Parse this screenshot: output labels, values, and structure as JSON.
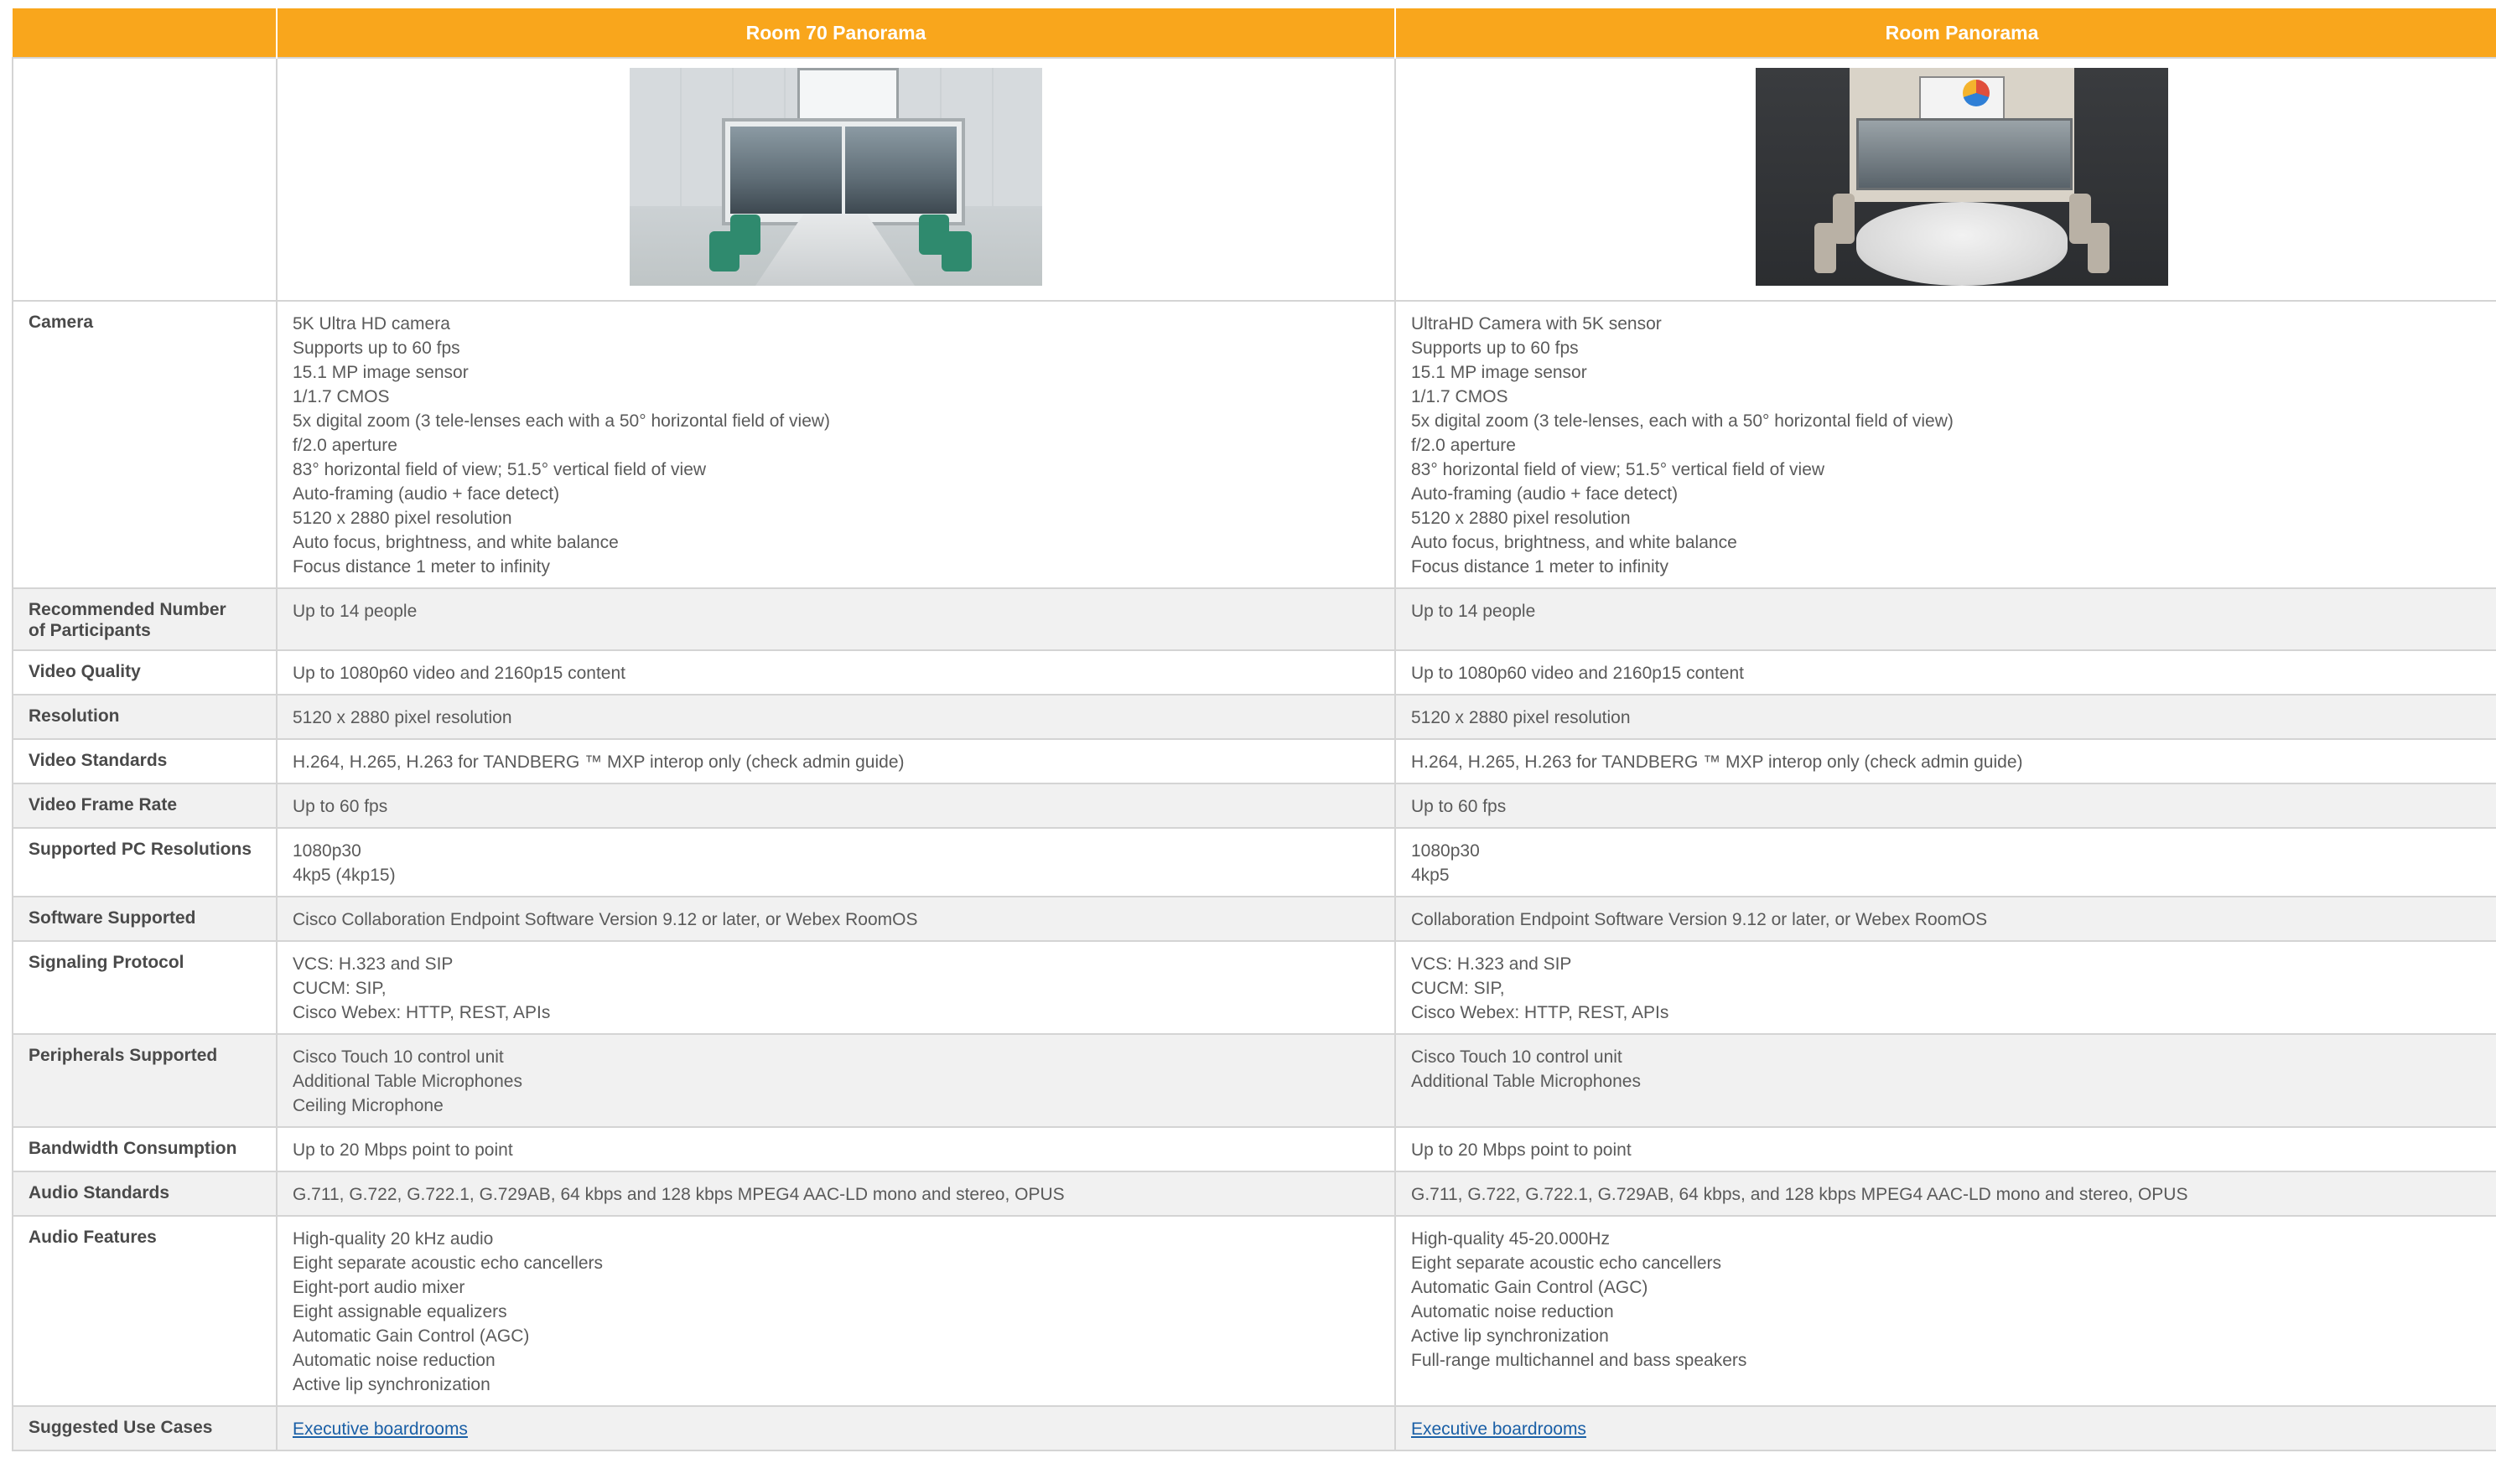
{
  "header": {
    "col1": "Room 70 Panorama",
    "col2": "Room Panorama"
  },
  "images": {
    "col1": "Room 70 Panorama meeting room photo",
    "col2": "Room Panorama meeting room photo"
  },
  "rows": [
    {
      "label": "Camera",
      "col1": [
        "5K Ultra HD camera",
        "Supports up to 60 fps",
        "15.1 MP image sensor",
        "1/1.7 CMOS",
        "5x digital zoom (3 tele-lenses each with a 50° horizontal field of view)",
        "f/2.0 aperture",
        "83° horizontal field of view; 51.5° vertical field of view",
        "Auto-framing (audio + face detect)",
        "5120 x 2880 pixel resolution",
        "Auto focus, brightness, and white balance",
        "Focus distance 1 meter to infinity"
      ],
      "col2": [
        "UltraHD Camera with 5K sensor",
        "Supports up to 60 fps",
        "15.1 MP image sensor",
        "1/1.7 CMOS",
        "5x digital zoom (3 tele-lenses, each with a 50° horizontal field of view)",
        "f/2.0 aperture",
        "83° horizontal field of view; 51.5° vertical field of view",
        "Auto-framing (audio + face detect)",
        "5120 x 2880 pixel resolution",
        "Auto focus, brightness, and white balance",
        "Focus distance 1 meter to infinity"
      ]
    },
    {
      "label_lines": [
        "Recommended Number",
        "of Participants"
      ],
      "col1": [
        "Up to 14 people"
      ],
      "col2": [
        "Up to 14 people"
      ]
    },
    {
      "label": "Video Quality",
      "col1": [
        "Up to 1080p60 video and 2160p15 content"
      ],
      "col2": [
        "Up to 1080p60 video and 2160p15 content"
      ]
    },
    {
      "label": "Resolution",
      "col1": [
        "5120 x 2880 pixel resolution"
      ],
      "col2": [
        "5120 x 2880 pixel resolution"
      ]
    },
    {
      "label": "Video Standards",
      "col1": [
        "H.264, H.265, H.263 for TANDBERG ™ MXP interop only (check admin guide)"
      ],
      "col2": [
        "H.264, H.265, H.263 for TANDBERG ™ MXP interop only (check admin guide)"
      ]
    },
    {
      "label": "Video Frame Rate",
      "col1": [
        "Up to 60 fps"
      ],
      "col2": [
        "Up to 60 fps"
      ]
    },
    {
      "label": "Supported PC Resolutions",
      "col1": [
        "1080p30",
        "4kp5 (4kp15)"
      ],
      "col2": [
        "1080p30",
        "4kp5"
      ]
    },
    {
      "label": "Software Supported",
      "col1": [
        "Cisco Collaboration Endpoint Software Version 9.12 or later, or Webex RoomOS"
      ],
      "col2": [
        "Collaboration Endpoint Software Version 9.12 or later, or Webex RoomOS"
      ]
    },
    {
      "label": "Signaling Protocol",
      "col1": [
        "VCS: H.323 and SIP",
        "CUCM: SIP,",
        "Cisco Webex: HTTP, REST, APIs"
      ],
      "col2": [
        "VCS: H.323 and SIP",
        "CUCM: SIP,",
        "Cisco Webex: HTTP, REST, APIs"
      ]
    },
    {
      "label": "Peripherals Supported",
      "col1": [
        "Cisco Touch 10 control unit",
        "Additional Table Microphones",
        "Ceiling Microphone"
      ],
      "col2": [
        "Cisco Touch 10 control unit",
        "Additional Table Microphones"
      ]
    },
    {
      "label": "Bandwidth Consumption",
      "col1": [
        "Up to 20 Mbps point to point"
      ],
      "col2": [
        "Up to 20 Mbps point to point"
      ]
    },
    {
      "label": "Audio Standards",
      "col1": [
        "G.711, G.722, G.722.1, G.729AB, 64 kbps and 128 kbps MPEG4 AAC-LD mono and stereo, OPUS"
      ],
      "col2": [
        "G.711, G.722, G.722.1, G.729AB, 64 kbps, and 128 kbps MPEG4 AAC-LD mono and stereo, OPUS"
      ]
    },
    {
      "label": "Audio Features",
      "col1": [
        "High-quality 20 kHz audio",
        "Eight separate acoustic echo cancellers",
        "Eight-port audio mixer",
        "Eight assignable equalizers",
        "Automatic Gain Control (AGC)",
        "Automatic noise reduction",
        "Active lip synchronization"
      ],
      "col2": [
        "High-quality 45-20.000Hz",
        "Eight separate acoustic echo cancellers",
        "Automatic Gain Control (AGC)",
        "Automatic noise reduction",
        "Active lip synchronization",
        "Full-range multichannel and bass speakers"
      ]
    },
    {
      "label": "Suggested Use Cases",
      "col1_link": "Executive boardrooms",
      "col2_link": "Executive boardrooms"
    }
  ],
  "colors": {
    "header_bg": "#f9a61c",
    "header_text": "#ffffff",
    "alt_row_bg": "#f1f1f1",
    "border": "#d4d4d4",
    "link": "#1a5fa6"
  }
}
